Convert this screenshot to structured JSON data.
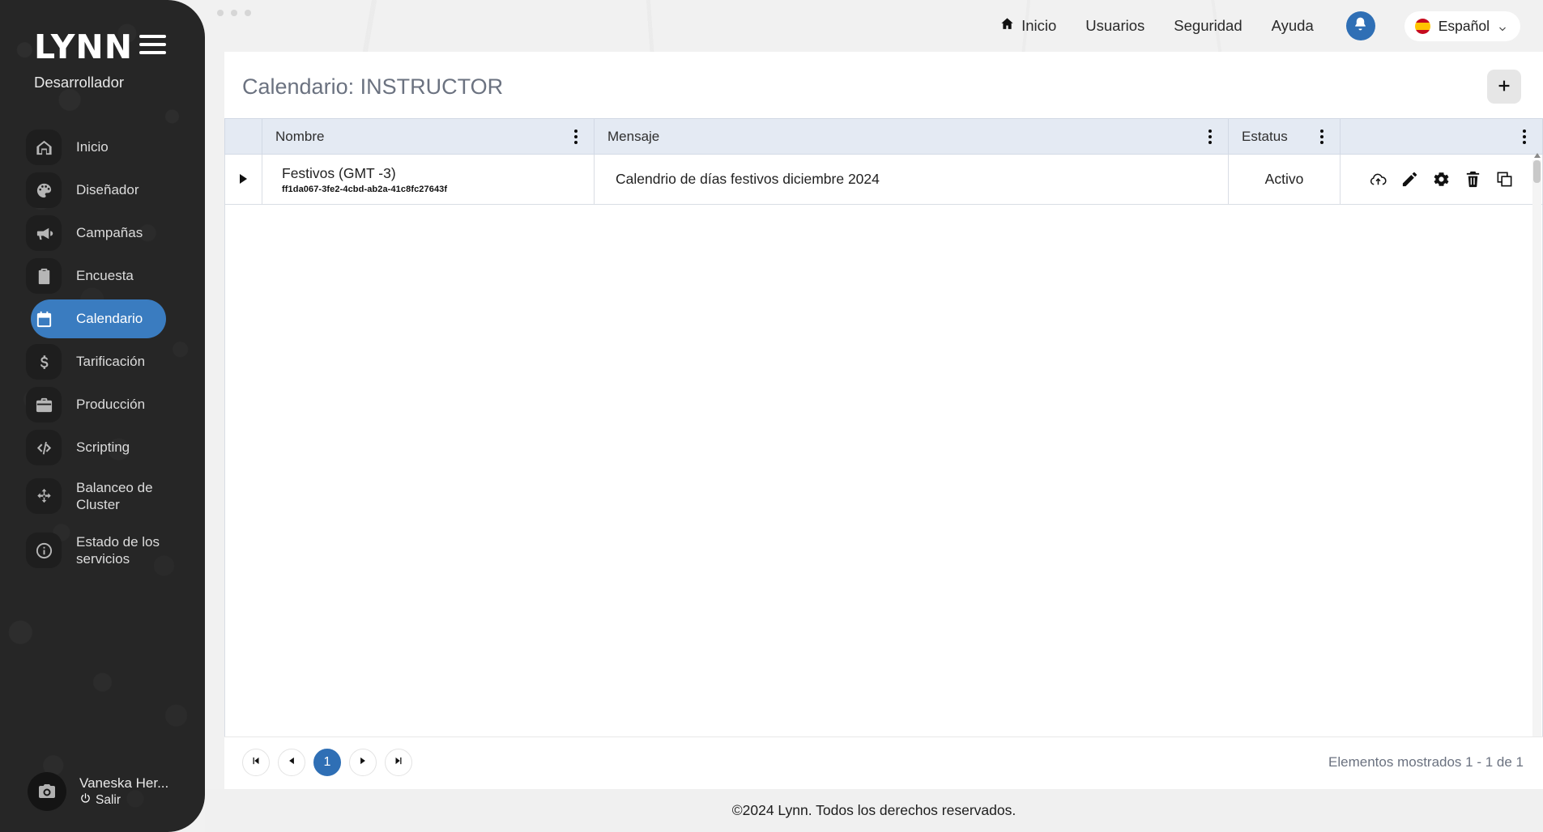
{
  "brand": {
    "logo_text": "LYNN",
    "subtitle": "Desarrollador",
    "menu_icon": "hamburger-icon"
  },
  "sidebar": {
    "items": [
      {
        "label": "Inicio",
        "icon": "home-icon",
        "active": false
      },
      {
        "label": "Diseñador",
        "icon": "palette-icon",
        "active": false
      },
      {
        "label": "Campañas",
        "icon": "megaphone-icon",
        "active": false
      },
      {
        "label": "Encuesta",
        "icon": "clipboard-icon",
        "active": false
      },
      {
        "label": "Calendario",
        "icon": "calendar-icon",
        "active": true
      },
      {
        "label": "Tarificación",
        "icon": "dollar-icon",
        "active": false
      },
      {
        "label": "Producción",
        "icon": "briefcase-icon",
        "active": false
      },
      {
        "label": "Scripting",
        "icon": "code-icon",
        "active": false
      },
      {
        "label": "Balanceo de Cluster",
        "icon": "arrows-move-icon",
        "active": false
      },
      {
        "label": "Estado de los servicios",
        "icon": "info-circle-icon",
        "active": false
      }
    ],
    "user": {
      "name": "Vaneska Her...",
      "logout_label": "Salir",
      "avatar_icon": "camera-icon",
      "logout_icon": "power-icon"
    }
  },
  "topnav": {
    "links": [
      {
        "label": "Inicio",
        "icon": "home-icon"
      },
      {
        "label": "Usuarios",
        "icon": ""
      },
      {
        "label": "Seguridad",
        "icon": ""
      },
      {
        "label": "Ayuda",
        "icon": ""
      }
    ],
    "notifications_icon": "bell-icon",
    "language": {
      "label": "Español",
      "flag": "spain-flag-icon",
      "chevron": "chevron-down-icon"
    }
  },
  "page": {
    "title": "Calendario: INSTRUCTOR",
    "add_button_icon": "plus-icon"
  },
  "table": {
    "columns": [
      {
        "key": "expander",
        "label": ""
      },
      {
        "key": "nombre",
        "label": "Nombre"
      },
      {
        "key": "mensaje",
        "label": "Mensaje"
      },
      {
        "key": "estatus",
        "label": "Estatus"
      },
      {
        "key": "acciones",
        "label": ""
      }
    ],
    "rows": [
      {
        "nombre": "Festivos (GMT -3)",
        "uuid": "ff1da067-3fe2-4cbd-ab2a-41c8fc27643f",
        "mensaje": "Calendrio de días festivos diciembre 2024",
        "estatus": "Activo",
        "actions": [
          "cloud-upload-icon",
          "edit-pencil-icon",
          "settings-gear-icon",
          "delete-trash-icon",
          "copy-duplicate-icon"
        ]
      }
    ]
  },
  "pagination": {
    "first_icon": "first-page-icon",
    "prev_icon": "prev-page-icon",
    "current_page": "1",
    "next_icon": "next-page-icon",
    "last_icon": "last-page-icon",
    "info": "Elementos mostrados 1 - 1 de 1"
  },
  "footer": {
    "copyright": "©2024 Lynn. Todos los derechos reservados."
  },
  "colors": {
    "accent_blue": "#2f6fb5",
    "sidebar_bg": "#262626",
    "active_nav": "#3a7cc0",
    "table_header": "#e4eaf3",
    "title_gray": "#6b7280"
  }
}
